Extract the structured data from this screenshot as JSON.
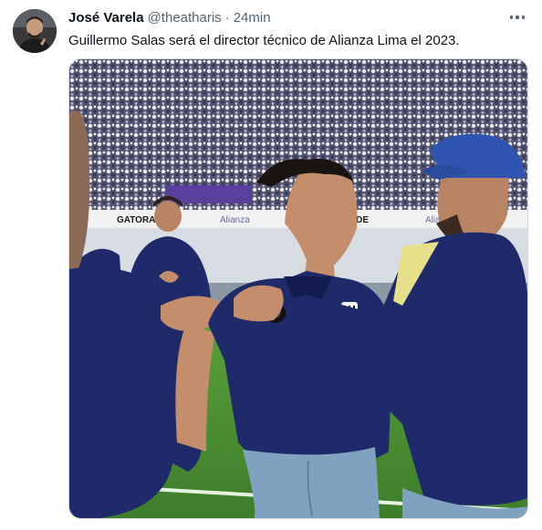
{
  "tweet": {
    "author_name": "José Varela",
    "handle": "@theatharis",
    "separator": "·",
    "time": "24min",
    "text": "Guillermo Salas será el director técnico de Alianza Lima el 2023."
  },
  "media": {
    "board_left": "GATORA",
    "board_mid": "Alianza",
    "board_right": "TORADE",
    "board_right2": "Alia"
  },
  "icons": {
    "more": "more-horizontal-icon"
  },
  "colors": {
    "text_primary": "#0f1419",
    "text_secondary": "#536471",
    "border": "#cfd9de",
    "jersey_navy": "#1f2a6b"
  }
}
